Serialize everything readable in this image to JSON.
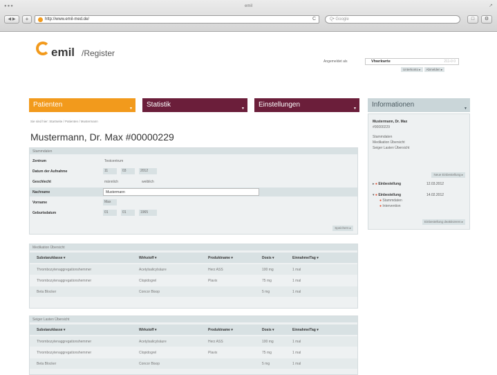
{
  "browser": {
    "title": "emil",
    "traffic_lights": "●●●",
    "nav_buttons": "◀ ▶",
    "add_tab": "+",
    "url": "http://www.emil-med.de/",
    "reload": "C",
    "search_placeholder": "Q• Google",
    "btn_bookmarks": "□",
    "btn_settings": "⚙",
    "resize": "↗"
  },
  "header": {
    "logo_word": "emil",
    "logo_sub": "/Register",
    "login_label": "Angemeldet als",
    "user_name": "Vhwrkwrte",
    "user_id": "211-0 0",
    "link1": "Unterkonto ▸",
    "link2": "Abmelden ▸"
  },
  "tabs": {
    "patienten": "Patienten",
    "statistik": "Statistik",
    "einstellungen": "Einstellungen",
    "informationen": "Informationen",
    "dropdown": "▼"
  },
  "breadcrumb": "Sie sind hier: Startseite / Patienten / Mustermann",
  "page_title": "Mustermann, Dr. Max #00000229",
  "stammdaten": {
    "heading": "Stammdaten",
    "rows": [
      {
        "label": "Zentrum",
        "value": "Testcentrum"
      },
      {
        "label": "Datum der Aufnahme",
        "d": "11",
        "m": "03",
        "y": "2012"
      },
      {
        "label": "Geschlecht",
        "value": "männlich",
        "value2": "weiblich"
      },
      {
        "label": "Nachname",
        "value": "Mustermann"
      },
      {
        "label": "Vorname",
        "value": "Max"
      },
      {
        "label": "Geburtsdatum",
        "d": "01",
        "m": "01",
        "y": "1965"
      }
    ],
    "more": "Speichern ▸"
  },
  "medication": {
    "heading": "Medikation Übersicht",
    "headers": [
      "Substanzklasse ▾",
      "Wirkstoff ▾",
      "Produktname ▾",
      "Dosis ▾",
      "Einnahme/Tag ▾"
    ],
    "rows": [
      [
        "Thrombozytenaggregationshemmer",
        "Acetylsalicylsäure",
        "Herz ASS",
        "100 mg",
        "1 mal"
      ],
      [
        "Thrombozytenaggregationshemmer",
        "Clopidogrel",
        "Plavix",
        "75 mg",
        "1 mal"
      ],
      [
        "Beta Blocker",
        "Concor Bisop",
        "",
        "5 mg",
        "1 mal"
      ]
    ]
  },
  "medication2": {
    "heading": "Seiger Lasten Übersicht",
    "headers": [
      "Substanzklasse ▾",
      "Wirkstoff ▾",
      "Produktname ▾",
      "Dosis ▾",
      "Einnahme/Tag ▾"
    ],
    "rows": [
      [
        "Thrombozytenaggregationshemmer",
        "Acetylsalicylsäure",
        "Herz ASS",
        "100 mg",
        "1 mal"
      ],
      [
        "Thrombozytenaggregationshemmer",
        "Clopidogrel",
        "Plavix",
        "75 mg",
        "1 mal"
      ],
      [
        "Beta Blocker",
        "Concor Bisop",
        "",
        "5 mg",
        "1 mal"
      ]
    ]
  },
  "info": {
    "name": "Mustermann, Dr. Max",
    "id": "#00000229",
    "lines": [
      "Stammdaten",
      "Medikation Übersicht",
      "Seiger Lasten Übersicht"
    ],
    "new_btn": "Neue Einbestellung ▸",
    "adm1_label": "Einbestellung",
    "adm1_date": "12.03.2012",
    "adm2_label": "Einbestellung",
    "adm2_date": "14.02.2012",
    "sub1": "Stammdaten",
    "sub2": "Intervention",
    "all_btn": "Einbestellung deaktivieren ▸",
    "arrow_closed": "▸",
    "arrow_open": "▾",
    "dot": "●"
  }
}
